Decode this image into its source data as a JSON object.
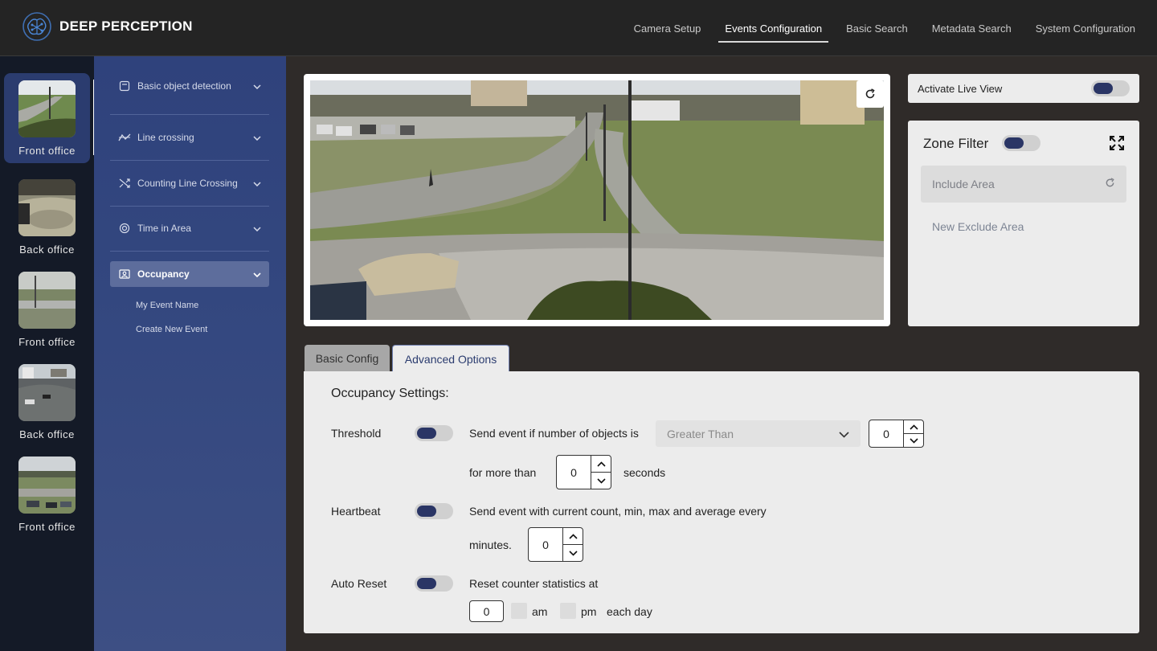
{
  "brand": {
    "name": "DEEP PERCEPTION"
  },
  "nav": {
    "items": [
      {
        "label": "Camera Setup"
      },
      {
        "label": "Events Configuration"
      },
      {
        "label": "Basic Search"
      },
      {
        "label": "Metadata Search"
      },
      {
        "label": "System Configuration"
      }
    ],
    "active": "Events Configuration"
  },
  "cameras": [
    {
      "label": "Front office",
      "active": true
    },
    {
      "label": "Back office",
      "active": false
    },
    {
      "label": "Front office",
      "active": false
    },
    {
      "label": "Back office",
      "active": false
    },
    {
      "label": "Front office",
      "active": false
    }
  ],
  "events": {
    "items": [
      {
        "label": "Basic object detection",
        "icon": "object-detection-icon"
      },
      {
        "label": "Line crossing",
        "icon": "line-crossing-icon"
      },
      {
        "label": "Counting Line Crossing",
        "icon": "shuffle-icon"
      },
      {
        "label": "Time in Area",
        "icon": "target-icon"
      },
      {
        "label": "Occupancy",
        "icon": "occupancy-icon"
      }
    ],
    "active": "Occupancy",
    "sub_items": [
      {
        "label": "My Event Name"
      },
      {
        "label": "Create New Event"
      }
    ]
  },
  "live_view": {
    "label": "Activate Live View",
    "enabled": true
  },
  "zone_filter": {
    "title": "Zone Filter",
    "enabled": true,
    "include_label": "Include Area",
    "exclude_label": "New Exclude Area"
  },
  "tabs": [
    {
      "label": "Basic Config",
      "active": false
    },
    {
      "label": "Advanced Options",
      "active": true
    }
  ],
  "occupancy": {
    "title": "Occupancy Settings:",
    "threshold": {
      "label": "Threshold",
      "enabled": true,
      "text": "Send event if number of objects is",
      "comparator": "Greater Than",
      "value": "0",
      "for_label": "for more than",
      "seconds_value": "0",
      "seconds_label": "seconds"
    },
    "heartbeat": {
      "label": "Heartbeat",
      "enabled": true,
      "text": "Send event with current count, min, max and average every",
      "minutes_label": "minutes.",
      "minutes_value": "0"
    },
    "auto_reset": {
      "label": "Auto Reset",
      "enabled": true,
      "text": "Reset counter statistics at",
      "hour_value": "0",
      "am_label": "am",
      "pm_label": "pm",
      "suffix": "each day"
    }
  },
  "colors": {
    "accent": "#2b3c6f",
    "sidebar": "#33477f",
    "toggle_knob": "#2a3565"
  }
}
